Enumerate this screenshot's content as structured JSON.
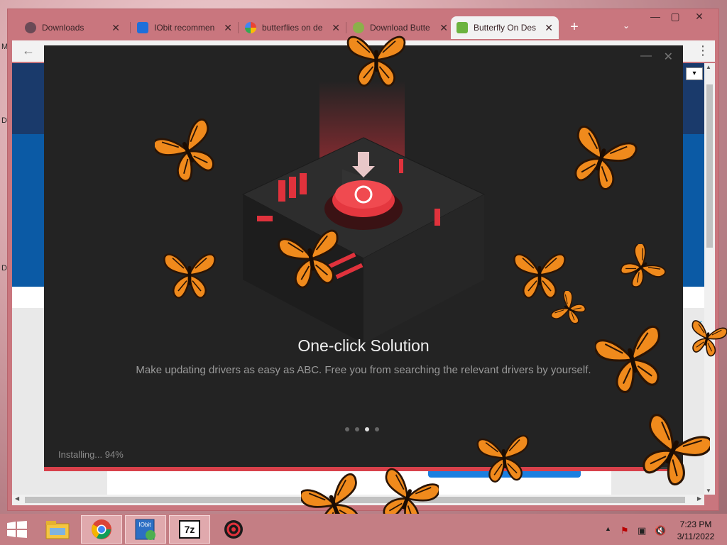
{
  "browser": {
    "tabs": [
      {
        "label": "Downloads",
        "active": false,
        "icon": "person-icon",
        "close": "✕"
      },
      {
        "label": "IObit recommen",
        "active": false,
        "icon": "iobit-icon",
        "close": "✕"
      },
      {
        "label": "butterflies on de",
        "active": false,
        "icon": "google-icon",
        "close": "✕"
      },
      {
        "label": "Download Butte",
        "active": false,
        "icon": "site-icon",
        "close": "✕"
      },
      {
        "label": "Butterfly On Des",
        "active": true,
        "icon": "download-arrow-icon",
        "close": "✕"
      }
    ],
    "new_tab": "+",
    "tab_menu": "⌄",
    "window_controls": {
      "minimize": "—",
      "maximize": "▢",
      "close": "✕"
    },
    "back": "←",
    "menu": "⋮"
  },
  "page": {
    "select_value": "▾",
    "ad_close": "✕"
  },
  "installer": {
    "minimize": "—",
    "close": "✕",
    "headline": "One-click Solution",
    "subline": "Make updating drivers as easy as ABC. Free you from searching the relevant drivers by yourself.",
    "progress_label": "Installing... 94%",
    "progress": 0.94,
    "carousel_dots": 4,
    "carousel_active": 2,
    "accent": "#d8404a"
  },
  "taskbar": {
    "apps": [
      "file-explorer-icon",
      "chrome-icon",
      "iobit-installer-icon",
      "7zip-icon",
      "driver-booster-icon"
    ],
    "seven_zip": "7z",
    "tray": {
      "up": "▲",
      "flag": "⚑",
      "network": "▣",
      "volume": "🔇"
    },
    "time": "7:23 PM",
    "date": "3/11/2022"
  },
  "colors": {
    "titlebar": "#c9767e",
    "taskbar": "#c47e84",
    "installer_bg": "#232323",
    "butterfly_orange": "#f08a1c"
  },
  "desktop_letters": [
    "M",
    "D",
    "D"
  ]
}
